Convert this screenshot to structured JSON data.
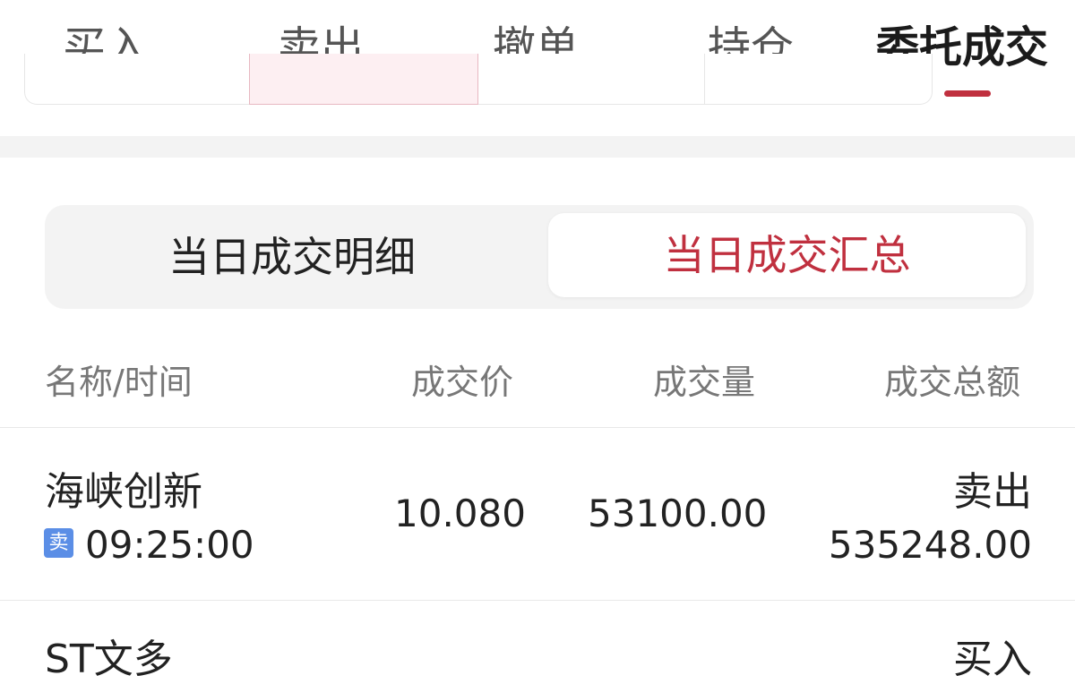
{
  "top_tabs": [
    "买入",
    "卖出",
    "撤单",
    "持仓",
    "委托成交"
  ],
  "active_top_tab": "委托成交",
  "segment": {
    "options": [
      "当日成交明细",
      "当日成交汇总"
    ],
    "active": "当日成交汇总"
  },
  "columns": [
    "名称/时间",
    "成交价",
    "成交量",
    "成交总额"
  ],
  "rows": [
    {
      "name": "海峡创新",
      "badge": "卖",
      "time": "09:25:00",
      "price": "10.080",
      "volume": "53100.00",
      "direction": "卖出",
      "amount": "535248.00"
    },
    {
      "name": "ST文多",
      "direction": "买入"
    }
  ],
  "colors": {
    "accent": "#c0303f",
    "badge_sell": "#5b8ee6",
    "text_primary": "#222222",
    "text_secondary": "#777777"
  }
}
